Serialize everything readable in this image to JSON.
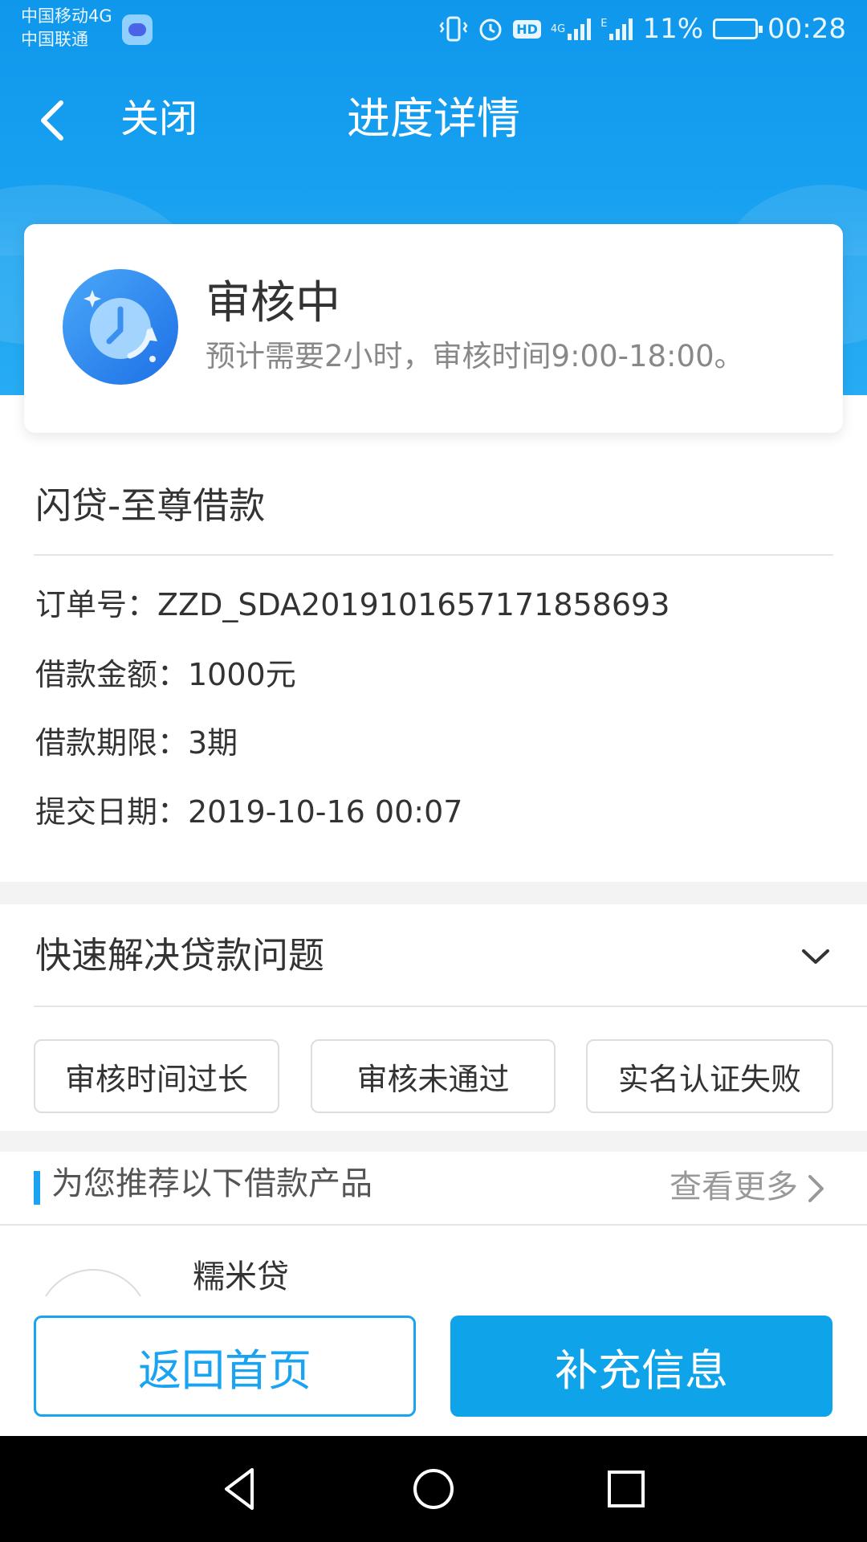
{
  "status_bar": {
    "carrier_1": "中国移动4G",
    "carrier_2": "中国联通",
    "network_1": "4G",
    "network_2": "E",
    "battery": "11%",
    "time": "00:28",
    "hd_label": "HD"
  },
  "nav": {
    "close_label": "关闭",
    "title": "进度详情"
  },
  "status_card": {
    "title": "审核中",
    "description": "预计需要2小时，审核时间9:00-18:00。"
  },
  "order": {
    "product_name": "闪贷-至尊借款",
    "order_no": "订单号：ZZD_SDA20191016571718586​93",
    "amount": "借款金额：1000元",
    "term": "借款期限：3期",
    "submit_date": "提交日期：2019-10-16 00:07"
  },
  "faq": {
    "title": "快速解决贷款问题",
    "chips": [
      "审核时间过长",
      "审核未通过",
      "实名认证失败"
    ]
  },
  "recommend": {
    "title": "为您推荐以下借款产品",
    "more": "查看更多",
    "product_name": "糯米贷"
  },
  "buttons": {
    "home": "返回首页",
    "supplement": "补充信息"
  },
  "colors": {
    "primary": "#0f97ec",
    "button_blue": "#0fa3ea"
  },
  "icons": {
    "back": "chevron-left-icon",
    "status": "clock-refresh-icon",
    "faq_toggle": "chevron-down-icon",
    "more": "chevron-right-icon"
  }
}
